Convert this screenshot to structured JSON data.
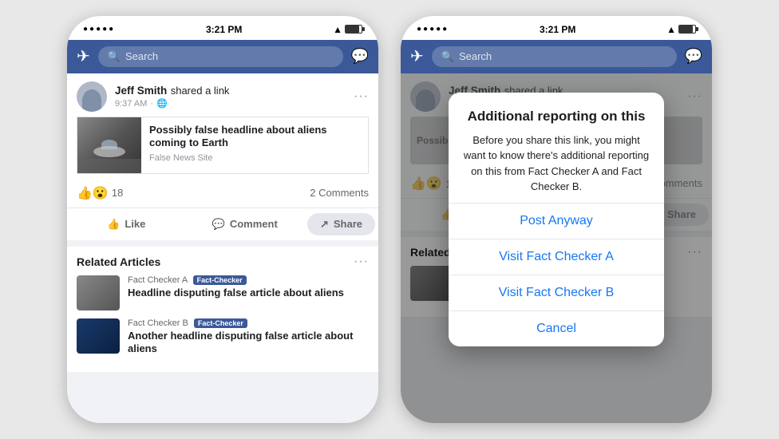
{
  "phone1": {
    "status_bar": {
      "dots": "●●●●●",
      "wifi": "wifi",
      "time": "3:21 PM",
      "battery": "battery"
    },
    "header": {
      "logo": "✈",
      "search_placeholder": "Search",
      "messenger": "messenger"
    },
    "post": {
      "username": "Jeff Smith",
      "action": "shared a link",
      "time": "9:37 AM",
      "privacy": "🌐",
      "headline": "Possibly false headline about aliens coming to Earth",
      "source": "False News Site",
      "reaction_emojis": "👍😮",
      "reaction_count": "18",
      "comments": "2 Comments",
      "like_label": "Like",
      "comment_label": "Comment",
      "share_label": "Share"
    },
    "related": {
      "title": "Related Articles",
      "items": [
        {
          "checker": "Fact Checker A",
          "badge": "Fact-Checker",
          "headline": "Headline disputing false article about aliens"
        },
        {
          "checker": "Fact Checker B",
          "badge": "Fact-Checker",
          "headline": "Another headline disputing false article about aliens"
        }
      ]
    }
  },
  "phone2": {
    "dialog": {
      "title": "Additional reporting on this",
      "body": "Before you share this link, you might want to know there's additional reporting on this from Fact Checker A and Fact Checker B.",
      "btn_post": "Post Anyway",
      "btn_checker_a": "Visit Fact Checker A",
      "btn_checker_b": "Visit Fact Checker B",
      "btn_cancel": "Cancel"
    }
  }
}
